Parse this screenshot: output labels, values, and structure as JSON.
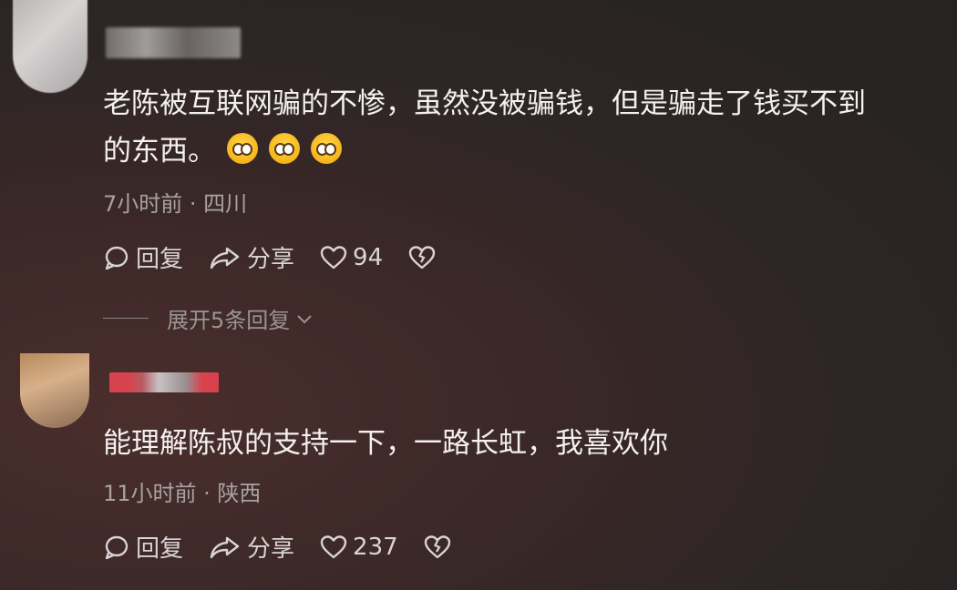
{
  "comments": [
    {
      "text_line1": "老陈被互联网骗的不惨，虽然没被骗钱，但是骗走了钱买不到",
      "text_line2": "的东西。",
      "emoji": [
        "pleading-face-icon",
        "pleading-face-icon",
        "pleading-face-icon"
      ],
      "meta": "7小时前 · 四川",
      "reply_label": "回复",
      "share_label": "分享",
      "like_count": "94",
      "expand_label": "展开5条回复"
    },
    {
      "text_line1": "能理解陈叔的支持一下，一路长虹，我喜欢你",
      "meta": "11小时前 · 陕西",
      "reply_label": "回复",
      "share_label": "分享",
      "like_count": "237"
    }
  ],
  "colors": {
    "background": "#2c2525",
    "text": "#f3f0f0",
    "meta": "#a8a2a2",
    "name_highlight": "#d8424e"
  }
}
